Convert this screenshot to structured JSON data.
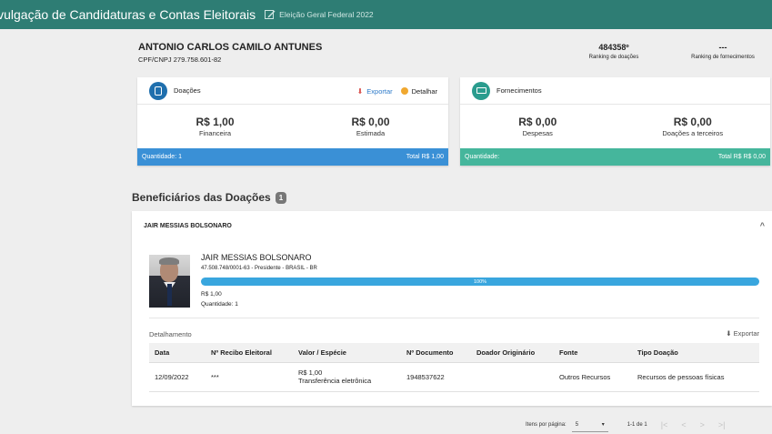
{
  "topbar": {
    "title": "Divulgação de Candidaturas e Contas Eleitorais",
    "title_visible": "ivulgação de Candidaturas e Contas Eleitorais",
    "election": "Eleição Geral Federal 2022"
  },
  "candidate": {
    "name": "ANTONIO CARLOS CAMILO ANTUNES",
    "cpf": "CPF/CNPJ 279.758.601-82"
  },
  "ranking": {
    "donations_value": "484358º",
    "donations_label": "Ranking de doações",
    "supply_value": "---",
    "supply_label": "Ranking de fornecimentos"
  },
  "donations_card": {
    "title": "Doações",
    "export_label": "Exportar",
    "detail_label": "Detalhar",
    "financial_value": "R$ 1,00",
    "financial_label": "Financeira",
    "estimated_value": "R$ 0,00",
    "estimated_label": "Estimada",
    "quantity": "Quantidade: 1",
    "total": "Total R$ 1,00"
  },
  "supplies_card": {
    "title": "Fornecimentos",
    "expenses_value": "R$ 0,00",
    "expenses_label": "Despesas",
    "third_value": "R$ 0,00",
    "third_label": "Doações a terceiros",
    "quantity": "Quantidade:",
    "total": "Total R$ R$ 0,00"
  },
  "beneficiaries": {
    "section_title": "Beneficiários das Doações",
    "count": "1",
    "panel_header": "JAIR MESSIAS BOLSONARO",
    "name": "JAIR MESSIAS BOLSONARO",
    "info": "47.508.748/0001-63 - Presidente - BRASIL - BR",
    "progress_label": "100%",
    "progress_fraction": 1.0,
    "value": "R$ 1,00",
    "quantity": "Quantidade: 1",
    "detail_heading": "Detalhamento",
    "export_label": "Exportar"
  },
  "table": {
    "headers": [
      "Data",
      "Nº Recibo Eleitoral",
      "Valor / Espécie",
      "Nº Documento",
      "Doador Originário",
      "Fonte",
      "Tipo Doação"
    ],
    "row": {
      "data": "12/09/2022",
      "recibo": "***",
      "valor": "R$ 1,00",
      "especie": "Transferência eletrônica",
      "documento": "1948537622",
      "doador": "",
      "fonte": "Outros Recursos",
      "tipo": "Recursos de pessoas físicas"
    }
  },
  "pagination": {
    "items_label": "Itens por página:",
    "page_size": "5",
    "range": "1-1 de 1"
  },
  "colors": {
    "topbar": "#2e7d74",
    "blue_footer": "#3a90d6",
    "green_footer": "#45b69c",
    "progress": "#39a6de"
  }
}
